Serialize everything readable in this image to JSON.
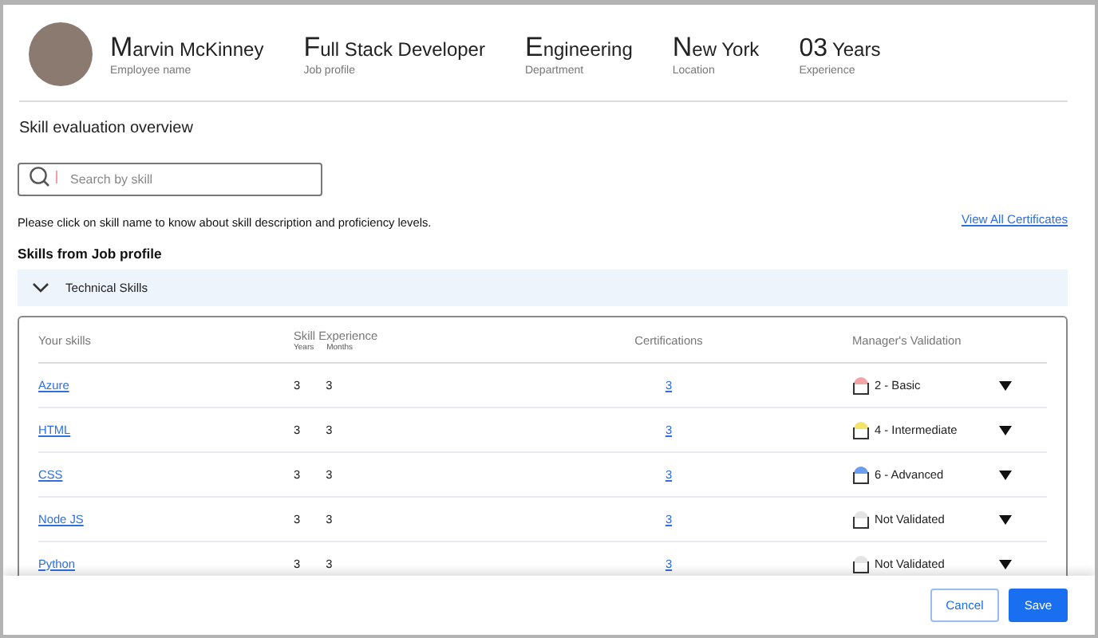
{
  "profile": {
    "fields": [
      {
        "value": "Marvin McKinney",
        "label": "Employee name"
      },
      {
        "value": "Full Stack Developer",
        "label": "Job profile"
      },
      {
        "value": "Engineering",
        "label": "Department"
      },
      {
        "value": "New York",
        "label": "Location"
      },
      {
        "value": "03",
        "unit": "Years",
        "label": "Experience"
      }
    ]
  },
  "section_title": "Skill evaluation overview",
  "search": {
    "placeholder": "Search by skill"
  },
  "hint": "Please click on skill name to know about skill description and proficiency levels.",
  "view_all_link": "View All Certificates",
  "group_title": "Skills from Job profile",
  "accordion": {
    "label": "Technical Skills",
    "expanded": true
  },
  "table": {
    "columns": [
      "Your skills",
      "Skill Experience",
      "Certifications",
      "Manager's Validation"
    ],
    "subcolumns": [
      "Years",
      "Months"
    ],
    "rows": [
      {
        "skill": "Azure",
        "years": "3",
        "months": "3",
        "certifications": "3",
        "validation": "2 - Basic",
        "color": "#f4a4a4"
      },
      {
        "skill": "HTML",
        "years": "3",
        "months": "3",
        "certifications": "3",
        "validation": "4 - Intermediate",
        "color": "#f3e46a"
      },
      {
        "skill": "CSS",
        "years": "3",
        "months": "3",
        "certifications": "3",
        "validation": "6 - Advanced",
        "color": "#6a9cf0"
      },
      {
        "skill": "Node JS",
        "years": "3",
        "months": "3",
        "certifications": "3",
        "validation": "Not Validated",
        "color": "#e4e4e4"
      },
      {
        "skill": "Python",
        "years": "3",
        "months": "3",
        "certifications": "3",
        "validation": "Not Validated",
        "color": "#e4e4e4"
      }
    ]
  },
  "buttons": [
    {
      "label": "Cancel",
      "kind": "secondary"
    },
    {
      "label": "Save",
      "kind": "primary"
    }
  ]
}
